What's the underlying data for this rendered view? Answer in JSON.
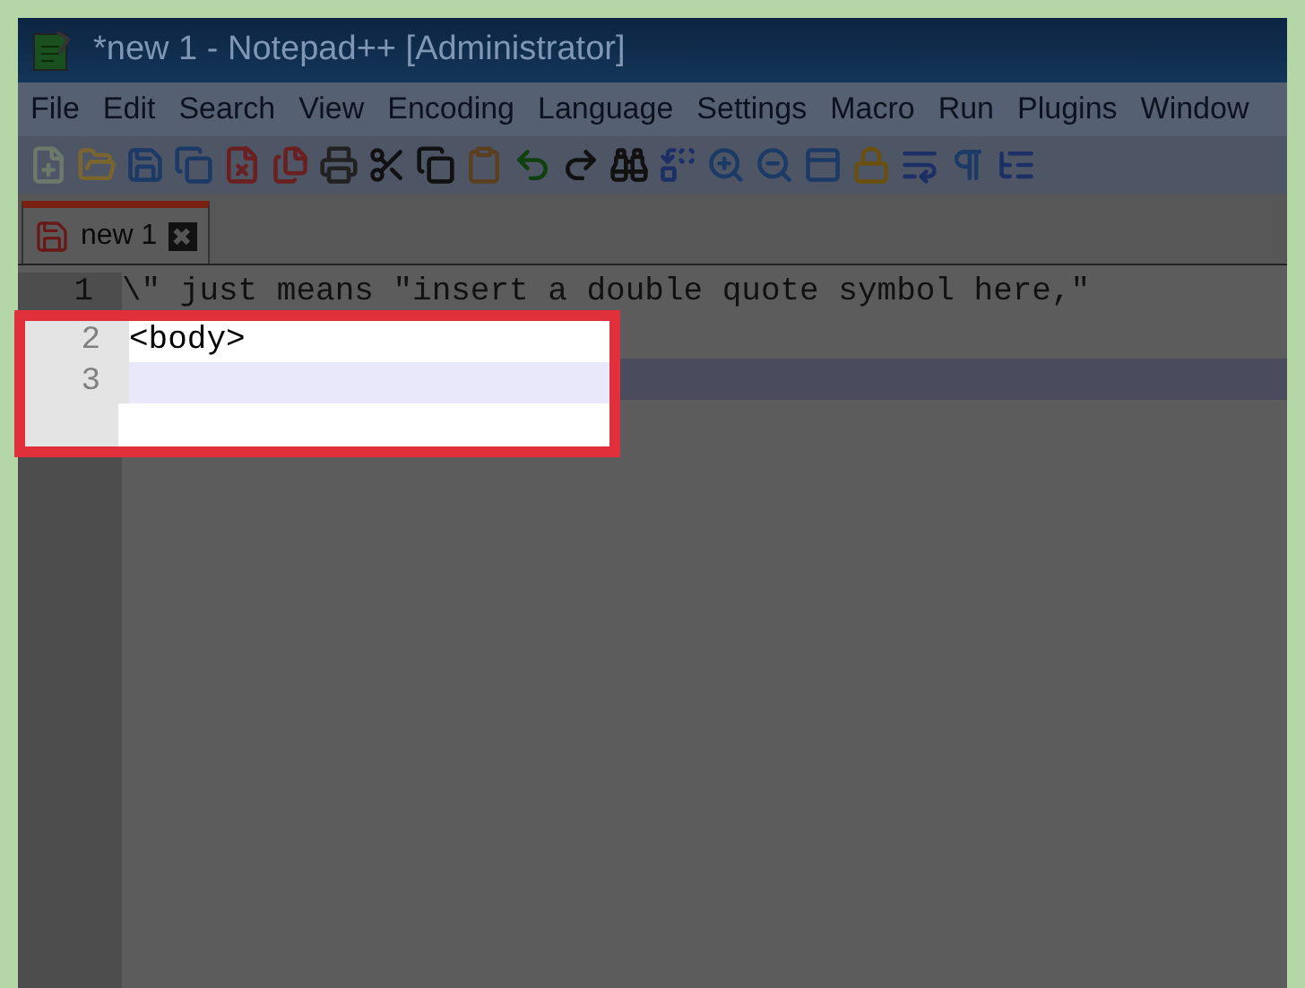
{
  "window": {
    "title": "*new 1 - Notepad++ [Administrator]"
  },
  "menu": [
    "File",
    "Edit",
    "Search",
    "View",
    "Encoding",
    "Language",
    "Settings",
    "Macro",
    "Run",
    "Plugins",
    "Window"
  ],
  "tabs": [
    {
      "label": "new 1",
      "selected": true,
      "close": "✖"
    }
  ],
  "lines": [
    {
      "number": "1",
      "text": "\\\" just means \"insert a double quote symbol here,\"",
      "highlighted": false,
      "current": false
    },
    {
      "number": "2",
      "text": "<body>",
      "highlighted": true,
      "current": false
    },
    {
      "number": "3",
      "highlighted": true,
      "current": true
    }
  ]
}
